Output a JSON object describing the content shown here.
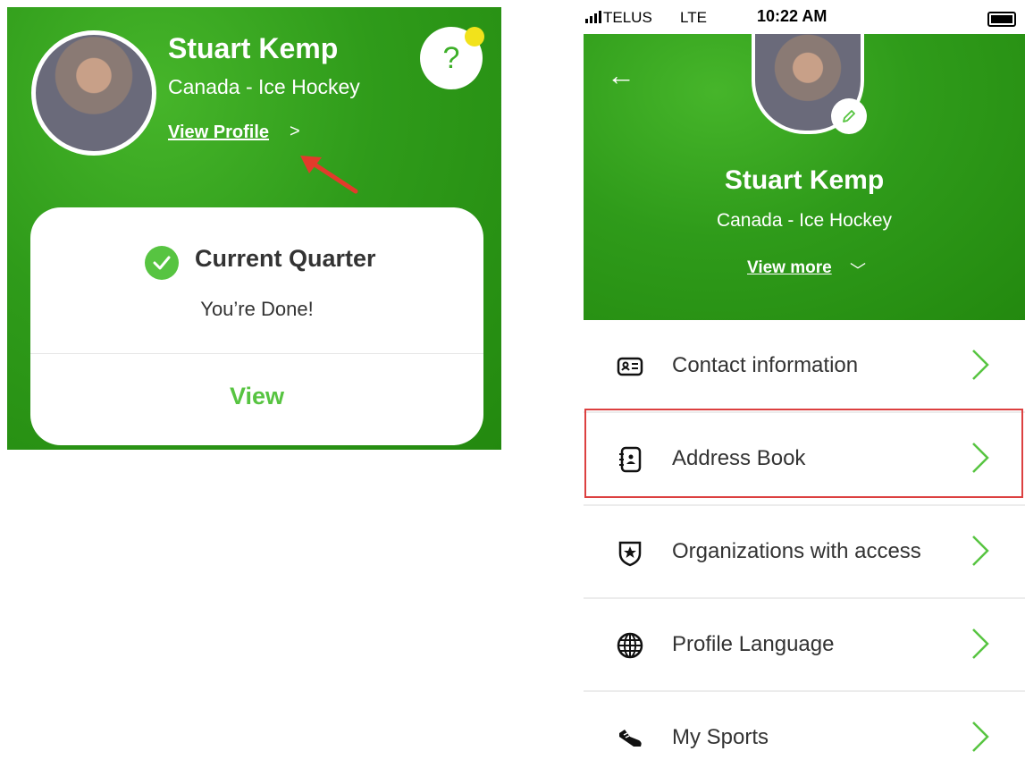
{
  "left_panel": {
    "name": "Stuart Kemp",
    "subtitle": "Canada - Ice Hockey",
    "view_profile": "View Profile",
    "view_profile_chevron": ">",
    "help_icon": "?",
    "card": {
      "title": "Current Quarter",
      "status": "You’re Done!",
      "action": "View"
    }
  },
  "right_panel": {
    "status_bar": {
      "carrier": "TELUS",
      "network": "LTE",
      "time": "10:22 AM"
    },
    "header": {
      "back_icon": "←",
      "name": "Stuart Kemp",
      "subtitle": "Canada - Ice Hockey",
      "view_more": "View more",
      "view_more_chevron": "﹀"
    },
    "menu": [
      {
        "label": "Contact information",
        "icon": "id-card-icon"
      },
      {
        "label": "Address Book",
        "icon": "address-book-icon"
      },
      {
        "label": "Organizations with access",
        "icon": "shield-star-icon"
      },
      {
        "label": "Profile Language",
        "icon": "globe-icon"
      },
      {
        "label": "My Sports",
        "icon": "sneaker-icon"
      }
    ]
  },
  "colors": {
    "brand_green": "#2f9b1a",
    "accent_green": "#57c441",
    "highlight_red": "#dc4040",
    "notification_yellow": "#f2e21b"
  }
}
